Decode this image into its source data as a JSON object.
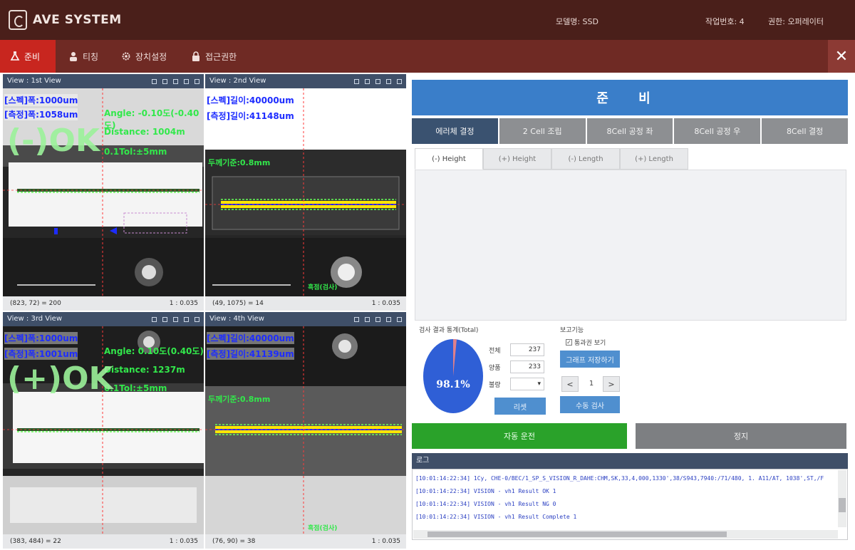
{
  "title_bar": {
    "app_title": "AVE SYSTEM",
    "model": "모델명: SSD",
    "work_no": "작업번호: 4",
    "permission": "권한: 오퍼레이터"
  },
  "toolbar": {
    "items": [
      {
        "label": "준비",
        "icon": "flask-icon"
      },
      {
        "label": "티칭",
        "icon": "person-icon"
      },
      {
        "label": "장치설정",
        "icon": "gear-icon"
      },
      {
        "label": "접근권한",
        "icon": "lock-icon"
      }
    ],
    "close_label": "✕"
  },
  "views": [
    {
      "header": "View : 1st View",
      "overlay_lines": [
        "[스펙]폭:1000um",
        "[측정]폭:1058um"
      ],
      "angle": "Angle: -0.10도(-0.40도)",
      "distance": "Distance: 1004m",
      "extra": "0.1Tol:±5mm",
      "result": "(-)OK",
      "footer_left": "(823, 72) = 200",
      "footer_right": "1 : 0.035"
    },
    {
      "header": "View : 2nd View",
      "overlay_lines": [
        "[스펙]길이:40000um",
        "[측정]길이:41148um"
      ],
      "extra": "두께기준:0.8mm",
      "bottom_label": "흑점(검사)",
      "footer_left": "(49, 1075) = 14",
      "footer_right": "1 : 0.035"
    },
    {
      "header": "View : 3rd View",
      "overlay_lines": [
        "[스펙]폭:1000um",
        "[측정]폭:1001um"
      ],
      "angle": "Angle: 0.10도(0.40도)",
      "distance": "Distance: 1237m",
      "extra": "0.1Tol:±5mm",
      "result": "(+)OK",
      "footer_left": "(383, 484) = 22",
      "footer_right": "1 : 0.035"
    },
    {
      "header": "View : 4th View",
      "overlay_lines": [
        "[스펙]길이:40000um",
        "[측정]길이:41139um"
      ],
      "extra": "두께기준:0.8mm",
      "bottom_label": "흑점(검사)",
      "footer_left": "(76, 90) = 38",
      "footer_right": "1 : 0.035"
    }
  ],
  "panel": {
    "banner": "준 비",
    "tabs": [
      "에러체 결정",
      "2 Cell 조립",
      "8Cell 공정 좌",
      "8Cell 공정 우",
      "8Cell 결정"
    ],
    "sub_tabs": [
      "(-) Height",
      "(+) Height",
      "(-) Length",
      "(+) Length"
    ],
    "stats_title": "검사 결과 통계(Total)",
    "pie_label": "98.1%",
    "pie_fraction": 0.981,
    "stats": [
      {
        "label": "전체",
        "value": "237"
      },
      {
        "label": "양품",
        "value": "233"
      },
      {
        "label": "불량",
        "value": "▾"
      }
    ],
    "reset_label": "리셋",
    "report_title": "보고기능",
    "checkbox_label": "통과권 보기",
    "graph_button": "그래프 저장하기",
    "prev": "<",
    "page": "1",
    "next": ">",
    "rotate_button": "수동 검사"
  },
  "actions": {
    "start_label": "자동 운전",
    "stop_label": "정지"
  },
  "log": {
    "title": "로그",
    "lines": [
      "[10:01:14:22:34] 1Cy, CHE-0/BEC/1_SP_S_VISION_R_DAHE:CHM,SK,33,4,000,1330',38/S943,7940:/71/480, 1. A11/AT, 1038',ST,/F",
      "[10:01:14:22:34] VISION - vh1 Result OK 1",
      "[10:01:14:22:34] VISION - vh1 Result NG 0",
      "[10:01:14:22:34] VISION - vh1 Result Complete 1"
    ]
  },
  "colors": {
    "titlebar": "#4a1f1a",
    "toolbar": "#6f2a24",
    "active_tab": "#c8261f",
    "banner": "#3a7ec9",
    "start": "#2aa22a"
  }
}
